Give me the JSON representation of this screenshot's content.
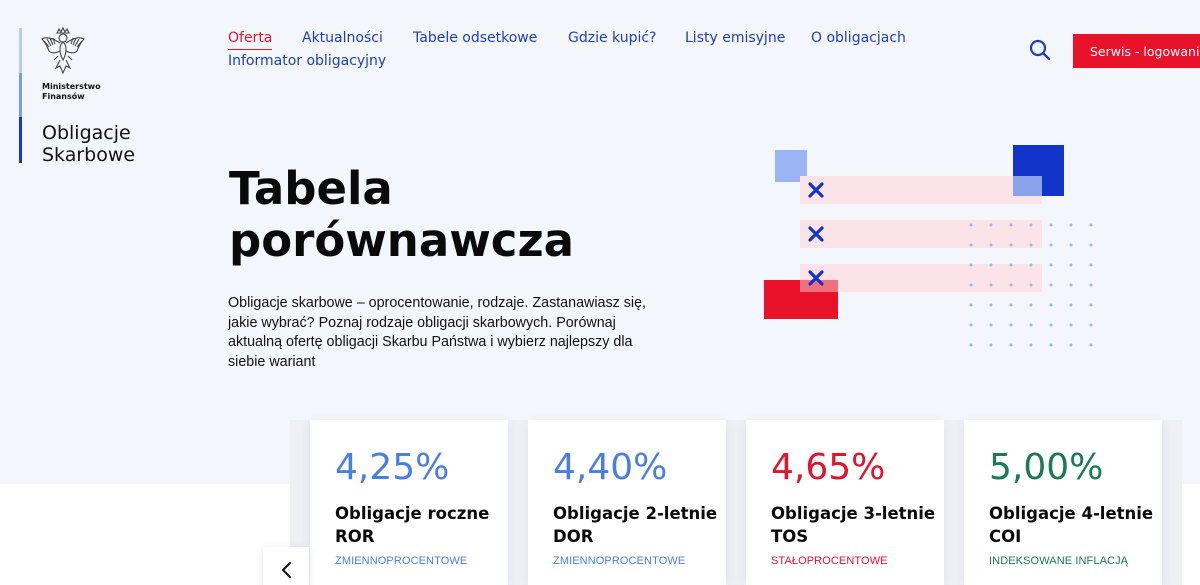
{
  "logo": {
    "ministry_line1": "Ministerstwo",
    "ministry_line2": "Finansów",
    "brand_line1": "Obligacje",
    "brand_line2": "Skarbowe"
  },
  "nav": {
    "items": [
      {
        "label": "Oferta",
        "active": true
      },
      {
        "label": "Aktualności"
      },
      {
        "label": "Tabele odsetkowe"
      },
      {
        "label": "Gdzie kupić?"
      },
      {
        "label": "Listy emisyjne"
      },
      {
        "label": "O obligacjach"
      },
      {
        "label": "Informator obligacyjny"
      }
    ],
    "search_icon": "search-icon",
    "login_label": "Serwis - logowanie"
  },
  "hero": {
    "title_line1": "Tabela",
    "title_line2": "porównawcza",
    "description": "Obligacje skarbowe – oprocentowanie, rodzaje. Zastanawiasz się, jakie wybrać? Poznaj rodzaje obligacji skarbowych. Porównaj aktualną ofertę obligacji Skarbu Państwa i wybierz najlepszy dla siebie wariant"
  },
  "cards": [
    {
      "rate": "4,25%",
      "name": "Obligacje roczne ROR",
      "type": "ZMIENNOPROCENTOWE",
      "color": "#4a7fe0"
    },
    {
      "rate": "4,40%",
      "name": "Obligacje 2-letnie DOR",
      "type": "ZMIENNOPROCENTOWE",
      "color": "#4a7fe0"
    },
    {
      "rate": "4,65%",
      "name": "Obligacje 3-letnie TOS",
      "type": "STAŁOPROCENTOWE",
      "color": "#e0142c"
    },
    {
      "rate": "5,00%",
      "name": "Obligacje 4-letnie COI",
      "type": "INDEKSOWANE INFLACJĄ",
      "color": "#1a7a56"
    }
  ],
  "carousel": {
    "prev_icon": "chevron-left-icon"
  },
  "colors": {
    "accent_red": "#e8132a",
    "nav_blue": "#1f3fb5",
    "hero_background": "#f3f6fc"
  }
}
